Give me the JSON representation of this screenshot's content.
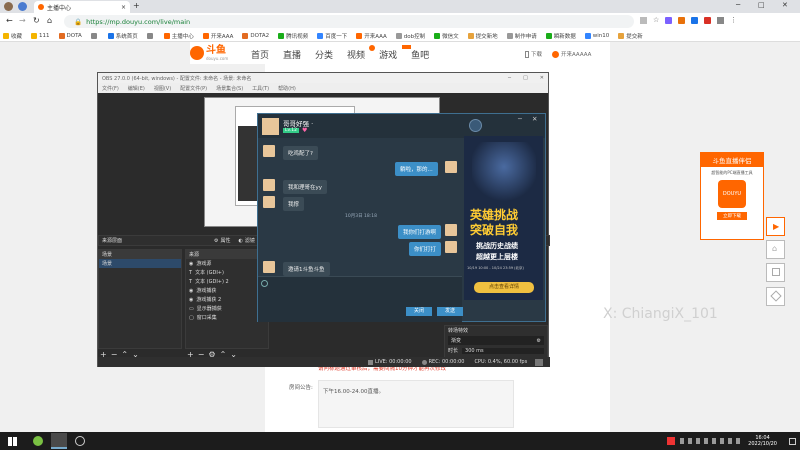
{
  "browser": {
    "tab_title": "主播中心",
    "new_tab": "+",
    "url": "https://mp.douyu.com/live/main",
    "bookmarks": [
      {
        "label": "收藏",
        "color": "#f4b400"
      },
      {
        "label": "111",
        "color": "#f4b400"
      },
      {
        "label": "DOTA",
        "color": "#e26b21"
      },
      {
        "label": "",
        "color": "#888"
      },
      {
        "label": "系统首页",
        "color": "#1a73e8"
      },
      {
        "label": "",
        "color": "#888"
      },
      {
        "label": "主播中心",
        "color": "#f60"
      },
      {
        "label": "开来AAA",
        "color": "#f60"
      },
      {
        "label": "DOTA2",
        "color": "#e26b21"
      },
      {
        "label": "腾讯视频",
        "color": "#1aad19"
      },
      {
        "label": "百度一下",
        "color": "#3385ff"
      },
      {
        "label": "开来AAA",
        "color": "#f60"
      },
      {
        "label": "dob控制",
        "color": "#999"
      },
      {
        "label": "微信文",
        "color": "#1aad19"
      },
      {
        "label": "提交新地",
        "color": "#e6a23c"
      },
      {
        "label": "制作申请",
        "color": "#999"
      },
      {
        "label": "瞬新数据",
        "color": "#1aad19"
      },
      {
        "label": "win10",
        "color": "#3385ff"
      },
      {
        "label": "提交新",
        "color": "#e6a23c"
      }
    ]
  },
  "site": {
    "logo": "斗鱼",
    "logo_sub": "douyu.com",
    "nav": [
      "首页",
      "直播",
      "分类",
      "视频",
      "游戏",
      "鱼吧"
    ],
    "right_links": [
      "下载",
      "开来AAAAA"
    ],
    "notice_label": "房间公告:",
    "notice_text": "下午16.00-24.00直播。",
    "warning_text": "请问标题通过审核后，需要间隔10分钟才能再次修改"
  },
  "obs": {
    "title": "OBS 27.0.0 (64-bit, windows) - 配置文件: 未命名 - 场景: 未命名",
    "menu": [
      "文件(F)",
      "编辑(E)",
      "视图(V)",
      "配置文件(P)",
      "场景集合(S)",
      "工具(T)",
      "帮助(H)"
    ],
    "audio_label": "来源层面",
    "properties_btn": "属性",
    "filters_btn": "滤镜",
    "scenes_header": "场景",
    "scenes": [
      "场景"
    ],
    "sources_header": "来源",
    "sources": [
      "游戏源",
      "文本 (GDI+)",
      "文本 (GDI+) 2",
      "游戏捕获",
      "游戏捕获 2",
      "显示器捕获",
      "窗口采集"
    ],
    "transitions_header": "转场特效",
    "transition_value": "渐变",
    "duration_label": "时长",
    "duration_value": "300 ms",
    "status": [
      "LIVE: 00:00:00",
      "REC: 00:00:00",
      "CPU: 0.4%, 60.00 fps"
    ]
  },
  "chat": {
    "name": "哥哥好强 ·",
    "level": "Lv.12",
    "day_label": "10月3日 18:18",
    "messages": [
      {
        "side": "left",
        "text": "吃鸡配了?"
      },
      {
        "side": "right",
        "text": "躺啦，那的..."
      },
      {
        "side": "left",
        "text": "我和理哥在yy"
      },
      {
        "side": "left",
        "text": "我撑"
      },
      {
        "side": "right",
        "text": "我你们打游啊"
      },
      {
        "side": "right",
        "text": "你们打打"
      },
      {
        "side": "left",
        "text": "邀请1斗鱼斗鱼"
      }
    ],
    "close_btn": "关闭",
    "send_btn": "发送",
    "ad": {
      "title": "英雄挑战",
      "title2": "突破自我",
      "line1": "挑战历史战绩",
      "line2": "超越更上层楼",
      "date": "10/19 10:00 - 10/24 23:59 (北京)",
      "cta": "点击查看详情"
    }
  },
  "watermark": "X: ChiangiX_101",
  "right_ad": {
    "title": "斗鱼直播伴侣",
    "desc": "超智能的PC端直播工具",
    "brand": "DOUYU",
    "btn": "立即下载"
  },
  "taskbar": {
    "time": "16:04",
    "date": "2022/10/20"
  }
}
